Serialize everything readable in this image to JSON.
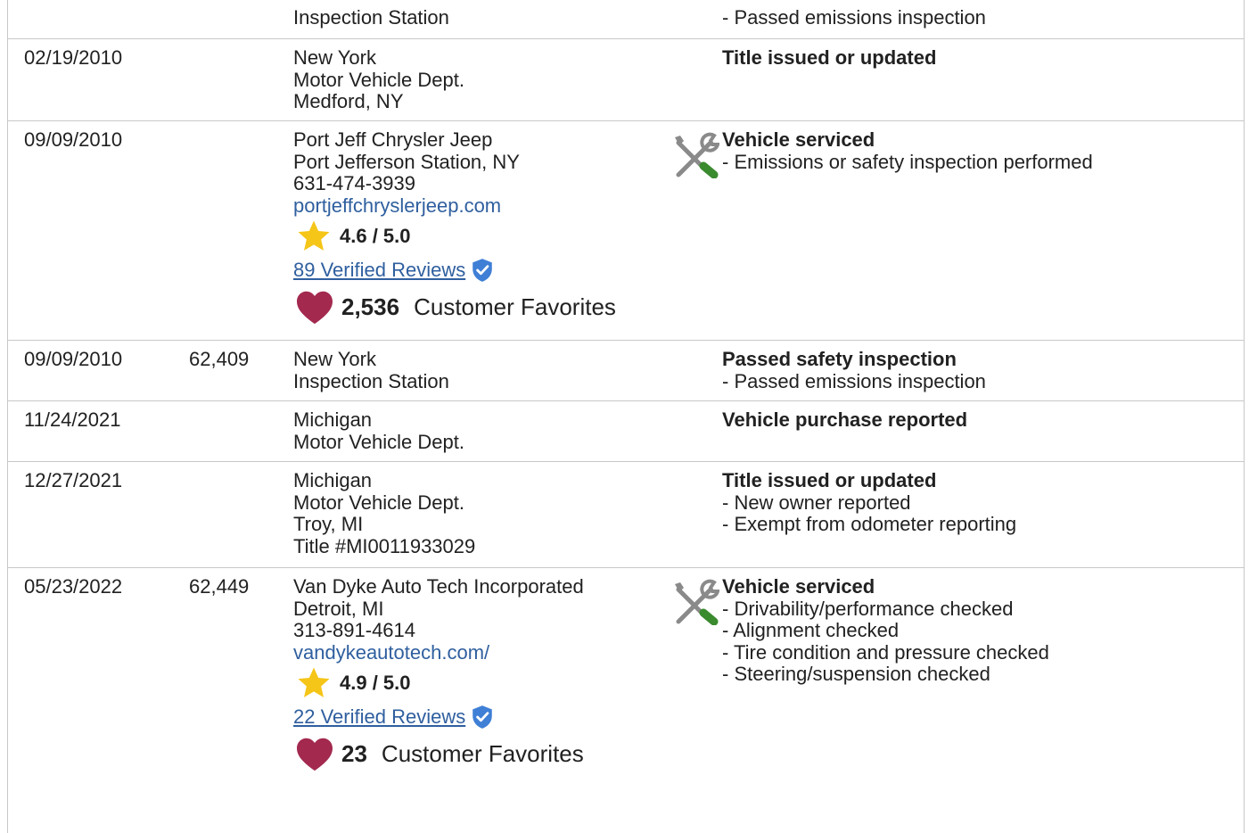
{
  "rows": [
    {
      "date": "",
      "odometer": "",
      "source": [
        "Inspection Station"
      ],
      "details": [
        "- Passed emissions inspection"
      ]
    },
    {
      "date": "02/19/2010",
      "odometer": "",
      "source": [
        "New York",
        "Motor Vehicle Dept.",
        "Medford, NY"
      ],
      "details_title": "Title issued or updated"
    },
    {
      "date": "09/09/2010",
      "odometer": "",
      "source": [
        "Port Jeff Chrysler Jeep",
        "Port Jefferson Station, NY",
        "631-474-3939"
      ],
      "website": "portjeffchryslerjeep.com",
      "rating": "4.6 / 5.0",
      "reviews": "89 Verified Reviews",
      "favorites_count": "2,536",
      "favorites_label": "Customer Favorites",
      "details_title": "Vehicle serviced",
      "details": [
        "- Emissions or safety inspection performed"
      ]
    },
    {
      "date": "09/09/2010",
      "odometer": "62,409",
      "source": [
        "New York",
        "Inspection Station"
      ],
      "details_title": "Passed safety inspection",
      "details": [
        "- Passed emissions inspection"
      ]
    },
    {
      "date": "11/24/2021",
      "odometer": "",
      "source": [
        "Michigan",
        "Motor Vehicle Dept."
      ],
      "details_title": "Vehicle purchase reported"
    },
    {
      "date": "12/27/2021",
      "odometer": "",
      "source": [
        "Michigan",
        "Motor Vehicle Dept.",
        "Troy, MI",
        "Title #MI0011933029"
      ],
      "details_title": "Title issued or updated",
      "details": [
        "- New owner reported",
        "- Exempt from odometer reporting"
      ]
    },
    {
      "date": "05/23/2022",
      "odometer": "62,449",
      "source": [
        "Van Dyke Auto Tech Incorporated",
        "Detroit, MI",
        "313-891-4614"
      ],
      "website": "vandykeautotech.com/",
      "rating": "4.9 / 5.0",
      "reviews": "22 Verified Reviews",
      "favorites_count": "23",
      "favorites_label": "Customer Favorites",
      "details_title": "Vehicle serviced",
      "details": [
        "- Drivability/performance checked",
        "- Alignment checked",
        "- Tire condition and pressure checked",
        "- Steering/suspension checked"
      ]
    }
  ],
  "icons": {
    "service": "wrench-screwdriver-icon",
    "rating": "star-icon",
    "verified": "verified-shield-icon",
    "favorites": "heart-icon"
  },
  "colors": {
    "link": "#2f5f9f",
    "star": "#f5c518",
    "heart": "#a3294f",
    "shield": "#3f7fd6",
    "tool_gray": "#8a8a8a",
    "tool_green": "#3a8a2e",
    "border": "#c8c8c8"
  }
}
